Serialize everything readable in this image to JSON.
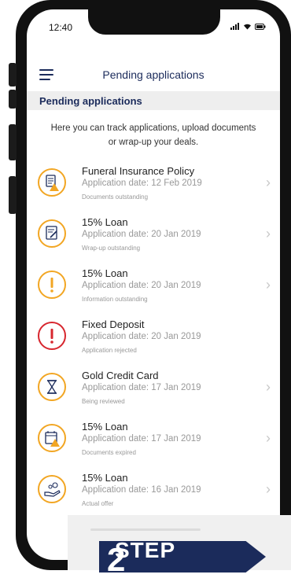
{
  "status_bar": {
    "time": "12:40"
  },
  "header": {
    "title": "Pending applications"
  },
  "section": {
    "title": "Pending applications"
  },
  "intro": "Here you can track applications, upload documents or wrap-up your deals.",
  "applications": [
    {
      "name": "Funeral Insurance Policy",
      "date": "Application date: 12 Feb 2019",
      "status": "Documents outstanding",
      "icon": "document-warning-icon",
      "color": "#f2a623",
      "chevron": "›"
    },
    {
      "name": "15% Loan",
      "date": "Application date: 20 Jan 2019",
      "status": "Wrap-up outstanding",
      "icon": "document-edit-icon",
      "color": "#f2a623",
      "chevron": "›"
    },
    {
      "name": "15% Loan",
      "date": "Application date: 20 Jan 2019",
      "status": "Information outstanding",
      "icon": "exclamation-icon",
      "color": "#f2a623",
      "chevron": "›"
    },
    {
      "name": "Fixed Deposit",
      "date": "Application date: 20 Jan 2019",
      "status": "Application rejected",
      "icon": "rejected-icon",
      "color": "#d7262e",
      "chevron": ""
    },
    {
      "name": "Gold Credit Card",
      "date": "Application date: 17 Jan 2019",
      "status": "Being reviewed",
      "icon": "hourglass-icon",
      "color": "#f2a623",
      "chevron": "›"
    },
    {
      "name": "15% Loan",
      "date": "Application date: 17 Jan 2019",
      "status": "Documents expired",
      "icon": "calendar-warning-icon",
      "color": "#f2a623",
      "chevron": "›"
    },
    {
      "name": "15% Loan",
      "date": "Application date: 16 Jan 2019",
      "status": "Actual offer",
      "icon": "hand-money-icon",
      "color": "#f2a623",
      "chevron": "›"
    }
  ],
  "step": {
    "label": "STEP",
    "number": "2"
  },
  "colors": {
    "brand": "#1b2b5b",
    "warning": "#f2a623",
    "error": "#d7262e"
  }
}
